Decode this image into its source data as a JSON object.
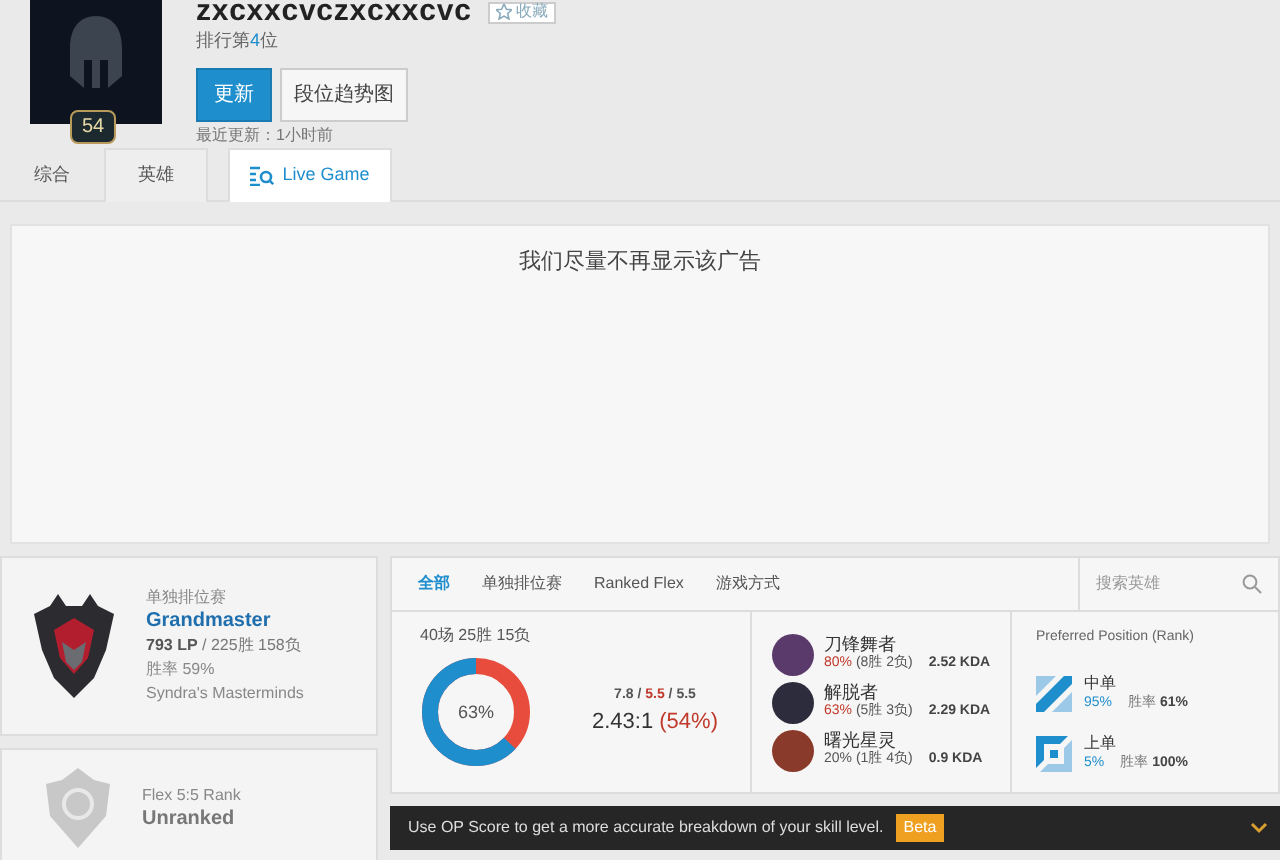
{
  "profile": {
    "name": "zxcxxcvczxcxxcvc",
    "favorite_label": "收藏",
    "level": "54",
    "rank": {
      "prefix": "排行第",
      "number": "4",
      "suffix": "位"
    },
    "buttons": [
      {
        "label": "更新",
        "kind": "primary"
      },
      {
        "label": "段位趋势图",
        "kind": "default"
      }
    ],
    "last_updated": "最近更新：1小时前"
  },
  "tabs": [
    {
      "label": "综合",
      "selected": true,
      "kind": "plain"
    },
    {
      "label": "英雄",
      "selected": false,
      "kind": "plain"
    },
    {
      "label": "Live Game",
      "selected": false,
      "kind": "live"
    }
  ],
  "ad": {
    "message": "我们尽量不再显示该广告"
  },
  "ranks": [
    {
      "queue": "单独排位赛",
      "tier": "Grandmaster",
      "lp": "793 LP",
      "record": " / 225胜 158负",
      "winrate": "胜率 59%",
      "league": "Syndra's Masterminds",
      "ranked": true
    },
    {
      "queue": "Flex 5:5 Rank",
      "tier": "Unranked",
      "ranked": false
    }
  ],
  "stats": {
    "tabs": [
      {
        "label": "全部",
        "selected": true
      },
      {
        "label": "单独排位赛",
        "selected": false
      },
      {
        "label": "Ranked Flex",
        "selected": false
      },
      {
        "label": "游戏方式",
        "selected": false
      }
    ],
    "search_placeholder": "搜索英雄",
    "summary": "40场 25胜 15负",
    "donut": {
      "label": "63%",
      "level": 0.63
    },
    "kda": {
      "kills": "7.8",
      "separator": "/",
      "deaths": "5.5",
      "assists": "5.5",
      "ratio": "2.43:1",
      "percent": "(54%)"
    },
    "champions": [
      {
        "name": "刀锋舞者",
        "winrate": "80%",
        "color": "#c0392b",
        "record": "(8胜 2负)",
        "kda": "2.52 KDA"
      },
      {
        "name": "解脱者",
        "winrate": "63%",
        "color": "#c0392b",
        "record": "(5胜 3负)",
        "kda": "2.29 KDA"
      },
      {
        "name": "曙光星灵",
        "winrate": "20%",
        "color": "#555555",
        "record": "(1胜 4负)",
        "kda": "0.9 KDA"
      }
    ],
    "positions_title": "Preferred Position (Rank)",
    "positions": [
      {
        "name": "中单",
        "share": "95%",
        "winrate_label": "胜率",
        "winrate": "61%",
        "kind": "mid"
      },
      {
        "name": "上单",
        "share": "5%",
        "winrate_label": "胜率",
        "winrate": "100%",
        "kind": "top"
      }
    ]
  },
  "notice": {
    "text": "Use OP Score to get a more accurate breakdown of your skill level.",
    "badge": "Beta"
  }
}
